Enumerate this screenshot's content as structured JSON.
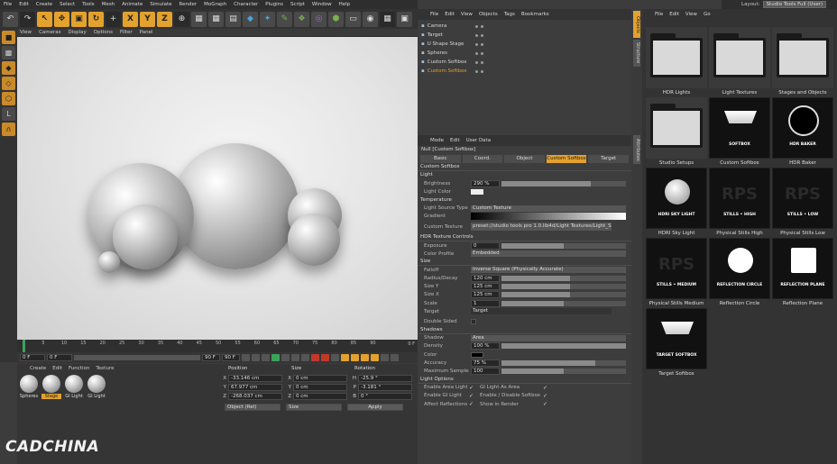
{
  "menu": [
    "File",
    "Edit",
    "Create",
    "Select",
    "Tools",
    "Mesh",
    "Animate",
    "Simulate",
    "Render",
    "MoGraph",
    "Character",
    "Plugins",
    "Script",
    "Window",
    "Help"
  ],
  "layout": {
    "label": "Layout:",
    "value": "Studio Tools Full (User)"
  },
  "viewport_menu": [
    "View",
    "Cameras",
    "Display",
    "Options",
    "Filter",
    "Panel"
  ],
  "timeline": {
    "ticks": [
      "0",
      "5",
      "10",
      "15",
      "20",
      "25",
      "30",
      "35",
      "40",
      "45",
      "50",
      "55",
      "60",
      "65",
      "70",
      "75",
      "80",
      "85",
      "90"
    ],
    "end": "0 F",
    "start_field": "0 F",
    "min_field": "0 F",
    "max_field": "90 F",
    "max2_field": "90 F"
  },
  "materials": {
    "menu": [
      "Create",
      "Edit",
      "Function",
      "Texture"
    ],
    "items": [
      {
        "name": "Spheres",
        "active": false
      },
      {
        "name": "Stage",
        "active": true
      },
      {
        "name": "GI Light",
        "active": false
      },
      {
        "name": "GI Light",
        "active": false
      }
    ]
  },
  "coords": {
    "headers": [
      "Position",
      "Size",
      "Rotation"
    ],
    "rows": [
      {
        "axis": "X",
        "pos": "-33.146 cm",
        "size": "0 cm",
        "rlab": "H",
        "rot": "-25.9 °"
      },
      {
        "axis": "Y",
        "pos": "67.977 cm",
        "size": "0 cm",
        "rlab": "P",
        "rot": "-3.181 °"
      },
      {
        "axis": "Z",
        "pos": "-268.037 cm",
        "size": "0 cm",
        "rlab": "B",
        "rot": "0 °"
      }
    ],
    "mode": "Object (Rel)",
    "size_mode": "Size",
    "apply": "Apply"
  },
  "object_manager": {
    "menu": [
      "File",
      "Edit",
      "View",
      "Objects",
      "Tags",
      "Bookmarks"
    ],
    "objects": [
      {
        "name": "Camera",
        "highlight": false
      },
      {
        "name": "Target",
        "highlight": false
      },
      {
        "name": "U Shape Stage",
        "highlight": false
      },
      {
        "name": "Spheres",
        "highlight": false
      },
      {
        "name": "Custom Softbox",
        "highlight": false
      },
      {
        "name": "Custom Softbox",
        "highlight": true
      }
    ]
  },
  "attributes": {
    "menu": [
      "Mode",
      "Edit",
      "User Data"
    ],
    "title": "Null [Custom Softbox]",
    "tabs": [
      {
        "label": "Basic",
        "active": false
      },
      {
        "label": "Coord.",
        "active": false
      },
      {
        "label": "Object",
        "active": false
      },
      {
        "label": "Custom Softbox",
        "active": true
      },
      {
        "label": "Target",
        "active": false
      }
    ],
    "section": "Custom Softbox",
    "light": "Light",
    "brightness": {
      "label": "Brightness",
      "value": "290 %",
      "level": 0.72
    },
    "light_color": "Light Color",
    "temperature": "Temperature",
    "light_source": {
      "label": "Light Source Type",
      "value": "Custom Texture"
    },
    "gradient": "Gradient",
    "custom_texture": {
      "label": "Custom Texture",
      "value": "preset://studio tools pro 1.0.lib4d/Light Textures/Light_Spot"
    },
    "hdr_controls": "HDR Texture Controls",
    "exposure": {
      "label": "Exposure",
      "value": "0",
      "level": 0.5
    },
    "color_profile": {
      "label": "Color Profile",
      "value": "Embedded"
    },
    "size": "Size",
    "falloff": {
      "label": "Falloff",
      "value": "Inverse Square (Physically Accurate)"
    },
    "radius": {
      "label": "Radius/Decay",
      "value": "120 cm",
      "level": 0.55
    },
    "size_y": {
      "label": "Size Y",
      "value": "125 cm",
      "level": 0.55
    },
    "size_x": {
      "label": "Size X",
      "value": "125 cm",
      "level": 0.55
    },
    "scale": {
      "label": "Scale",
      "value": "1",
      "level": 0.5
    },
    "target": {
      "label": "Target",
      "value": "Target"
    },
    "double_sided": "Double Sided",
    "shadows": "Shadows",
    "shadow": {
      "label": "Shadow",
      "value": "Area"
    },
    "density": {
      "label": "Density",
      "value": "100 %",
      "level": 1.0
    },
    "color": "Color",
    "accuracy": {
      "label": "Accuracy",
      "value": "75 %",
      "level": 0.75
    },
    "max_samples": {
      "label": "Maximum Samples",
      "value": "100",
      "level": 0.5
    },
    "light_options": "Light Options",
    "options_left": [
      "Enable Area Light",
      "Enable GI Light",
      "Affect Reflections"
    ],
    "options_right": [
      "GI Light As Area",
      "Enable / Disable Softbox",
      "Show in Render"
    ]
  },
  "side_tabs": [
    "Objects",
    "Attributes",
    "Structure"
  ],
  "browser": {
    "menu": [
      "File",
      "Edit",
      "View",
      "Go"
    ],
    "items": [
      {
        "label": "HDR Lights",
        "kind": "folder",
        "caption": ""
      },
      {
        "label": "Light Textures",
        "kind": "folder",
        "caption": ""
      },
      {
        "label": "Stages and Objects",
        "kind": "folder",
        "caption": ""
      },
      {
        "label": "Studio Setups",
        "kind": "folder",
        "caption": ""
      },
      {
        "label": "Custom Softbox",
        "kind": "softbox",
        "caption": "SOFTBOX"
      },
      {
        "label": "HDR Baker",
        "kind": "baker",
        "caption": "HDR BAKER"
      },
      {
        "label": "HDRI Sky Light",
        "kind": "sky",
        "caption": "HDRI SKY LIGHT"
      },
      {
        "label": "Physical Stills High",
        "kind": "rps",
        "caption": "STILLS • HIGH"
      },
      {
        "label": "Physical Stills Low",
        "kind": "rps",
        "caption": "STILLS • LOW"
      },
      {
        "label": "Physical Stills Medium",
        "kind": "rps",
        "caption": "STILLS • MEDIUM"
      },
      {
        "label": "Reflection Circle",
        "kind": "circle",
        "caption": "REFLECTION CIRCLE"
      },
      {
        "label": "Reflection Plane",
        "kind": "plane",
        "caption": "REFLECTION PLANE"
      },
      {
        "label": "Target Softbox",
        "kind": "softbox",
        "caption": "TARGET SOFTBOX"
      }
    ]
  },
  "watermark": "CADCHINA",
  "rps_text": "RPS",
  "colors": {
    "accent": "#e3a12e",
    "panel": "#3d3d3d",
    "toolbar": "#333333"
  }
}
